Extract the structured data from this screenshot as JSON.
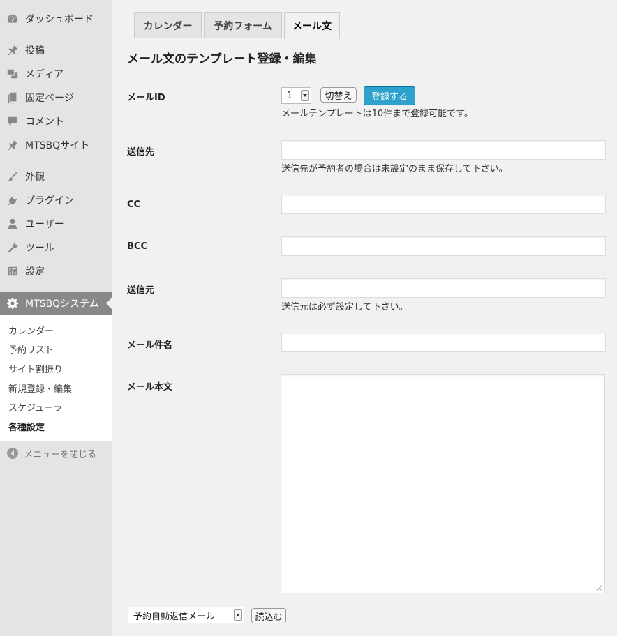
{
  "sidebar": {
    "items": [
      {
        "label": "ダッシュボード",
        "icon": "dashboard-icon"
      },
      {
        "label": "投稿",
        "icon": "pin-icon"
      },
      {
        "label": "メディア",
        "icon": "media-icon"
      },
      {
        "label": "固定ページ",
        "icon": "page-icon"
      },
      {
        "label": "コメント",
        "icon": "comment-icon"
      },
      {
        "label": "MTSBQサイト",
        "icon": "pin-icon"
      },
      {
        "label": "外観",
        "icon": "brush-icon"
      },
      {
        "label": "プラグイン",
        "icon": "plug-icon"
      },
      {
        "label": "ユーザー",
        "icon": "user-icon"
      },
      {
        "label": "ツール",
        "icon": "wrench-icon"
      },
      {
        "label": "設定",
        "icon": "settings-icon"
      },
      {
        "label": "MTSBQシステム",
        "icon": "gear-icon"
      }
    ],
    "submenu": [
      "カレンダー",
      "予約リスト",
      "サイト割振り",
      "新規登録・編集",
      "スケジューラ",
      "各種設定"
    ],
    "collapse_label": "メニューを閉じる"
  },
  "tabs": [
    "カレンダー",
    "予約フォーム",
    "メール文"
  ],
  "page_title": "メール文のテンプレート登録・編集",
  "form": {
    "mail_id_label": "メールID",
    "mail_id_value": "1",
    "switch_button": "切替え",
    "register_button": "登録する",
    "mail_id_hint": "メールテンプレートは10件まで登録可能です。",
    "to_label": "送信先",
    "to_hint": "送信先が予約者の場合は未設定のまま保存して下さい。",
    "cc_label": "CC",
    "bcc_label": "BCC",
    "from_label": "送信元",
    "from_hint": "送信元は必ず設定して下さい。",
    "subject_label": "メール件名",
    "body_label": "メール本文",
    "template_select_value": "予約自動返信メール",
    "load_button": "読込む"
  },
  "colors": {
    "primary_button": "#2ea2cc",
    "active_menu": "#888888"
  }
}
